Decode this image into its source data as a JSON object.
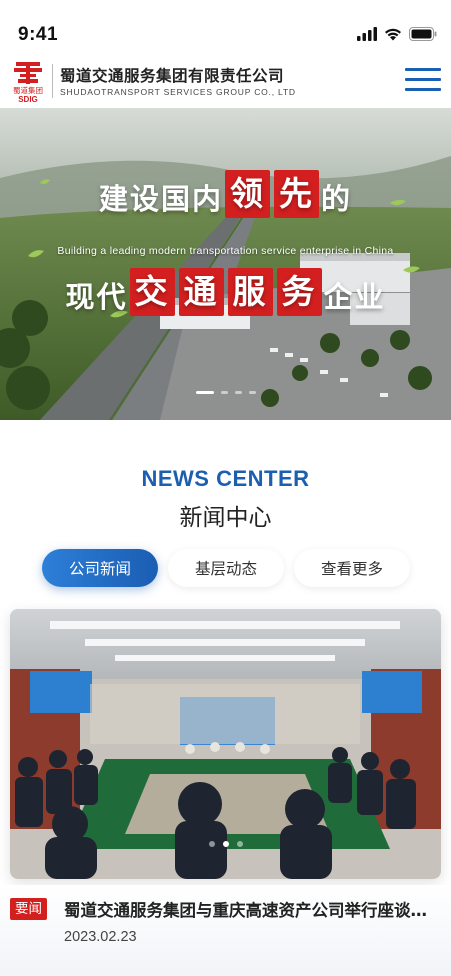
{
  "status_bar": {
    "time": "9:41"
  },
  "header": {
    "logo_text": "蜀道集团",
    "logo_sub": "SDIG",
    "company_name_cn": "蜀道交通服务集团有限责任公司",
    "company_name_en": "SHUDAOTRANSPORT SERVICES GROUP CO., LTD",
    "menu_icon": "hamburger-menu-icon"
  },
  "banner": {
    "line1_a": "建设国内",
    "line1_red_1": "领",
    "line1_red_2": "先",
    "line1_b": "的",
    "line2": "Building a leading modern transportation service enterprise in China",
    "line3_a": "现代",
    "line3_red_1": "交",
    "line3_red_2": "通",
    "line3_red_3": "服",
    "line3_red_4": "务",
    "line3_b": "企业",
    "slide_count": 4,
    "active_slide": 1
  },
  "news_section": {
    "title_en": "NEWS CENTER",
    "title_cn": "新闻中心",
    "tabs": [
      {
        "label": "公司新闻",
        "active": true
      },
      {
        "label": "基层动态",
        "active": false
      },
      {
        "label": "查看更多",
        "active": false
      }
    ],
    "featured": {
      "badge": "要闻",
      "title": "蜀道交通服务集团与重庆高速资产公司举行座谈交流",
      "date": "2023.02.23",
      "carousel_count": 3,
      "active_index": 2
    }
  },
  "colors": {
    "brand_blue": "#1c5fb0",
    "accent_red": "#d31f1f"
  }
}
